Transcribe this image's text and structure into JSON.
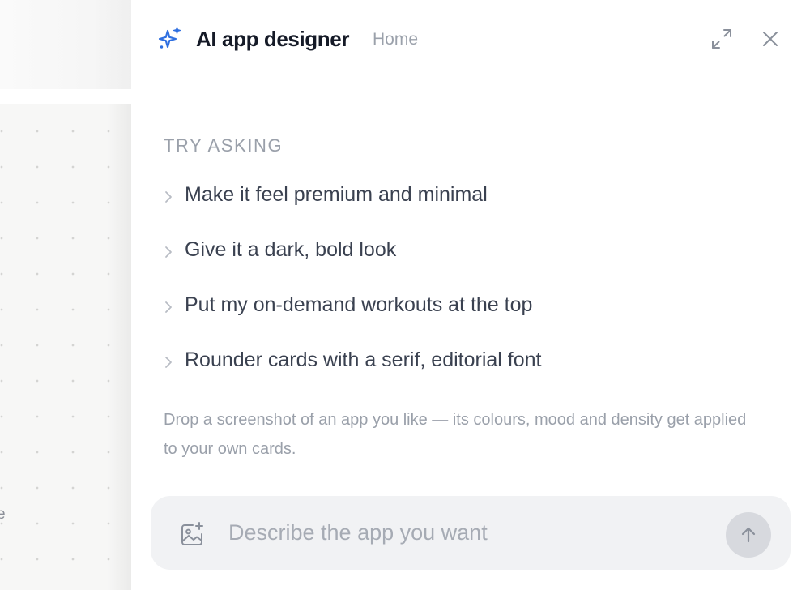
{
  "background": {
    "fragment_text": "e"
  },
  "panel": {
    "title": "AI app designer",
    "breadcrumb": "Home",
    "icons": {
      "title": "sparkle-icon",
      "expand": "expand-icon",
      "close": "close-icon"
    },
    "accent_color": "#2f6fe0"
  },
  "suggestions": {
    "heading": "TRY ASKING",
    "items": [
      {
        "label": "Make it feel premium and minimal"
      },
      {
        "label": "Give it a dark, bold look"
      },
      {
        "label": "Put my on-demand workouts at the top"
      },
      {
        "label": "Rounder cards with a serif, editorial font"
      }
    ],
    "hint": "Drop a screenshot of an app you like — its colours, mood and density get applied to your own cards."
  },
  "composer": {
    "placeholder": "Describe the app you want",
    "value": "",
    "icons": {
      "attach": "image-add-icon",
      "send": "arrow-up-icon"
    }
  }
}
